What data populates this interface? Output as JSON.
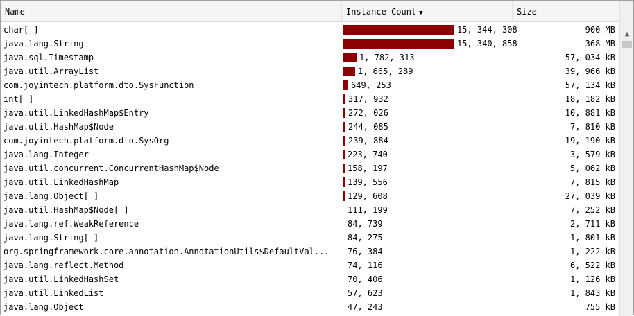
{
  "columns": {
    "name": "Name",
    "count": "Instance Count",
    "size": "Size",
    "sort_indicator": "▼"
  },
  "max_count": 15344308,
  "rows": [
    {
      "name": "char[ ]",
      "count": "15, 344, 308",
      "count_value": 15344308,
      "size": "900 MB"
    },
    {
      "name": "java.lang.String",
      "count": "15, 340, 858",
      "count_value": 15340858,
      "size": "368 MB"
    },
    {
      "name": "java.sql.Timestamp",
      "count": "1, 782, 313",
      "count_value": 1782313,
      "size": "57, 034 kB"
    },
    {
      "name": "java.util.ArrayList",
      "count": "1, 665, 289",
      "count_value": 1665289,
      "size": "39, 966 kB"
    },
    {
      "name": "com.joyintech.platform.dto.SysFunction",
      "count": "649, 253",
      "count_value": 649253,
      "size": "57, 134 kB"
    },
    {
      "name": "int[ ]",
      "count": "317, 932",
      "count_value": 317932,
      "size": "18, 182 kB"
    },
    {
      "name": "java.util.LinkedHashMap$Entry",
      "count": "272, 026",
      "count_value": 272026,
      "size": "10, 881 kB"
    },
    {
      "name": "java.util.HashMap$Node",
      "count": "244, 085",
      "count_value": 244085,
      "size": "7, 810 kB"
    },
    {
      "name": "com.joyintech.platform.dto.SysOrg",
      "count": "239, 884",
      "count_value": 239884,
      "size": "19, 190 kB"
    },
    {
      "name": "java.lang.Integer",
      "count": "223, 740",
      "count_value": 223740,
      "size": "3, 579 kB"
    },
    {
      "name": "java.util.concurrent.ConcurrentHashMap$Node",
      "count": "158, 197",
      "count_value": 158197,
      "size": "5, 062 kB"
    },
    {
      "name": "java.util.LinkedHashMap",
      "count": "139, 556",
      "count_value": 139556,
      "size": "7, 815 kB"
    },
    {
      "name": "java.lang.Object[ ]",
      "count": "129, 608",
      "count_value": 129608,
      "size": "27, 039 kB"
    },
    {
      "name": "java.util.HashMap$Node[ ]",
      "count": "111, 199",
      "count_value": 111199,
      "size": "7, 252 kB"
    },
    {
      "name": "java.lang.ref.WeakReference",
      "count": "84, 739",
      "count_value": 84739,
      "size": "2, 711 kB"
    },
    {
      "name": "java.lang.String[ ]",
      "count": "84, 275",
      "count_value": 84275,
      "size": "1, 801 kB"
    },
    {
      "name": "org.springframework.core.annotation.AnnotationUtils$DefaultVal...",
      "count": "76, 384",
      "count_value": 76384,
      "size": "1, 222 kB"
    },
    {
      "name": "java.lang.reflect.Method",
      "count": "74, 116",
      "count_value": 74116,
      "size": "6, 522 kB"
    },
    {
      "name": "java.util.LinkedHashSet",
      "count": "70, 406",
      "count_value": 70406,
      "size": "1, 126 kB"
    },
    {
      "name": "java.util.LinkedList",
      "count": "57, 623",
      "count_value": 57623,
      "size": "1, 843 kB"
    },
    {
      "name": "java.lang.Object",
      "count": "47, 243",
      "count_value": 47243,
      "size": "755 kB"
    }
  ],
  "colors": {
    "bar": "#8b0000"
  },
  "scrollbar": {
    "up_icon": "scroll-up-arrow-icon"
  }
}
